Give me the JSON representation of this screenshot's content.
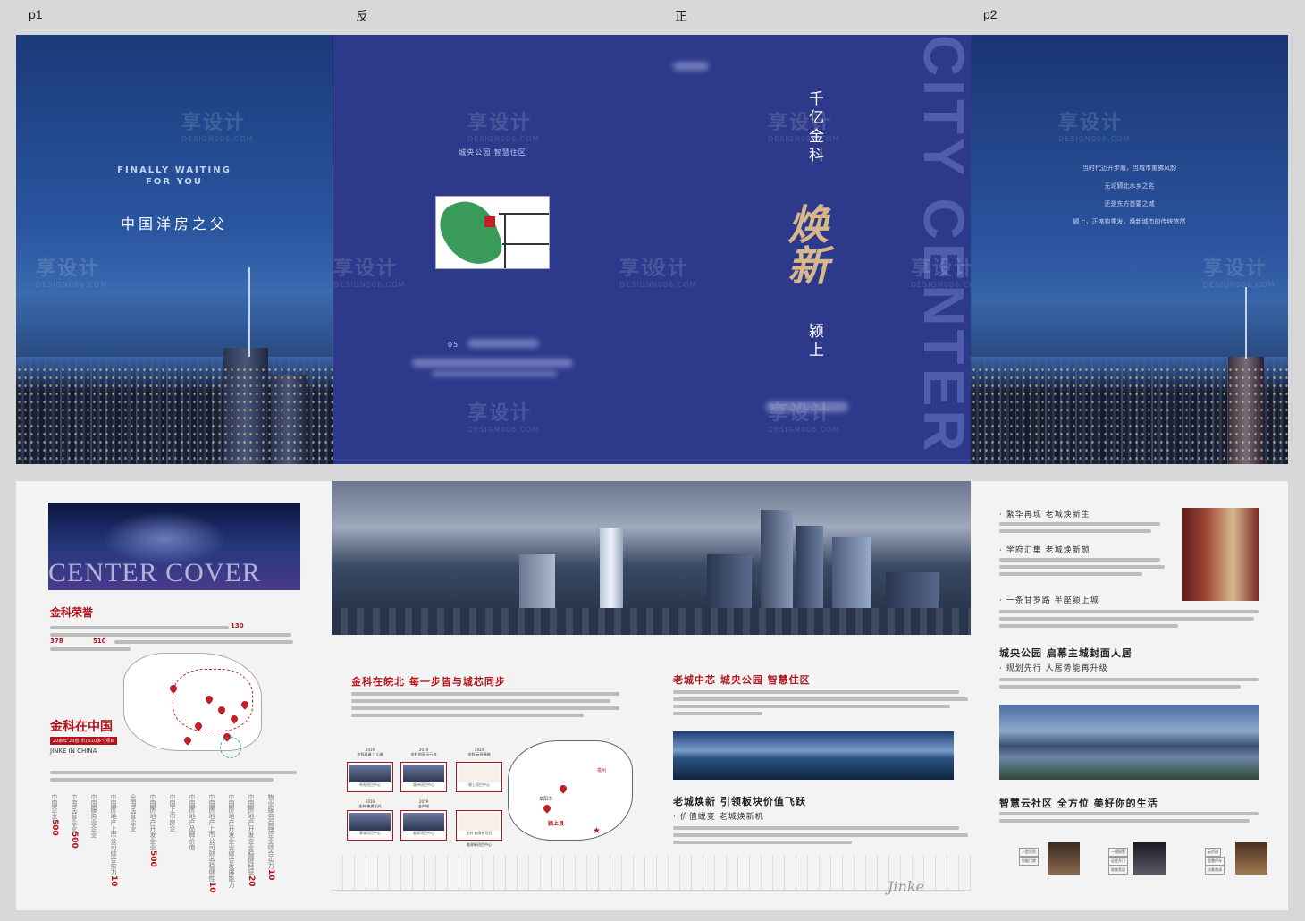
{
  "labels": {
    "p1": "p1",
    "back": "反",
    "front": "正",
    "p2": "p2"
  },
  "p1": {
    "en_line1": "FINALLY WAITING",
    "en_line2": "FOR YOU",
    "cn_title": "中国洋房之父"
  },
  "watermark": {
    "cn": "享设计",
    "en": "DESIGN006.COM"
  },
  "back": {
    "subtitle": "城央公园 智慧住区",
    "page_num": "05"
  },
  "front": {
    "line1": "千亿金科",
    "main": "焕新",
    "line2": "颍上",
    "vertical_en": "CITY CENTER"
  },
  "p2": {
    "poem": [
      "当时代迈开步履，当城市重拂风韵",
      "无论颍北水乡之名",
      "还是东方首要之城",
      "颍上，正席构重发，焕新城市的传统悠然"
    ]
  },
  "bottom_left": {
    "cover_text": "CENTER COVER",
    "honor_title": "金科荣誉",
    "nums": [
      "130",
      "378",
      "510"
    ],
    "china_title": "金科在中国",
    "china_sub": "20余年 23省(市) 510多个项目",
    "china_en": "JINKE IN CHINA",
    "stats": [
      {
        "num": "500",
        "text": "中国企业"
      },
      {
        "num": "500",
        "text": "中国民营企业"
      },
      {
        "num": "",
        "text": "中国服务业企业"
      },
      {
        "num": "10",
        "text": "中国房地产上市公司综合实力"
      },
      {
        "num": "",
        "text": "全国民营企业"
      },
      {
        "num": "500",
        "text": "中国房地产开发企业"
      },
      {
        "num": "",
        "text": "中国上市房企"
      },
      {
        "num": "",
        "text": "中国房地产品牌价值"
      },
      {
        "num": "10",
        "text": "中国房地产上市公司财务稳健性"
      },
      {
        "num": "",
        "text": "中国房地产开发企业综合发展能力"
      },
      {
        "num": "20",
        "text": "中国房地产开发企业稳健经营"
      },
      {
        "num": "10",
        "text": "物业服务百强企业综合实力"
      }
    ]
  },
  "bottom_mid": {
    "section1": "金科在皖北 每一步皆与城芯同步",
    "projects": [
      {
        "year": "2019",
        "name": "金科观澜·江山城",
        "cap": "阜阳项目中心"
      },
      {
        "year": "2019",
        "name": "金科花园·天元府",
        "cap": "颍州项目中心"
      },
      {
        "year": "2020",
        "name": "金科·云邸春晓",
        "cap": "颍上项目中心"
      },
      {
        "year": "2019",
        "name": "金科·集美阳光",
        "cap": "蒙城项目中心"
      },
      {
        "year": "2019",
        "name": "金科城",
        "cap": "临泉项目中心"
      },
      {
        "year": "2020",
        "name": "金科·临泉新项目",
        "cap": "临泉新项目中心"
      }
    ],
    "map_labels": [
      "亳州",
      "阜阳市",
      "颍上县"
    ],
    "section2": "老城中芯 城央公园 智慧住区",
    "section3": "老城焕新 引领板块价值飞跃",
    "section3_sub": "价值蜕变 老城焕新机",
    "footer_logo": "Jinke"
  },
  "bottom_right": {
    "b1": "繁华再现 老城焕新生",
    "b2": "学府汇集 老城焕新颜",
    "b3": "一条甘罗路 半座颍上城",
    "h1": "城央公园 启幕主城封面人居",
    "h1_sub": "规划先行 人居势能再升级",
    "h2": "智慧云社区 全方位 美好你的生活",
    "tags": [
      "人脸识别",
      "智能门禁",
      "一键报警",
      "远程开门",
      "智能家居",
      "云对讲",
      "智慧停车",
      "访客邀请"
    ]
  }
}
